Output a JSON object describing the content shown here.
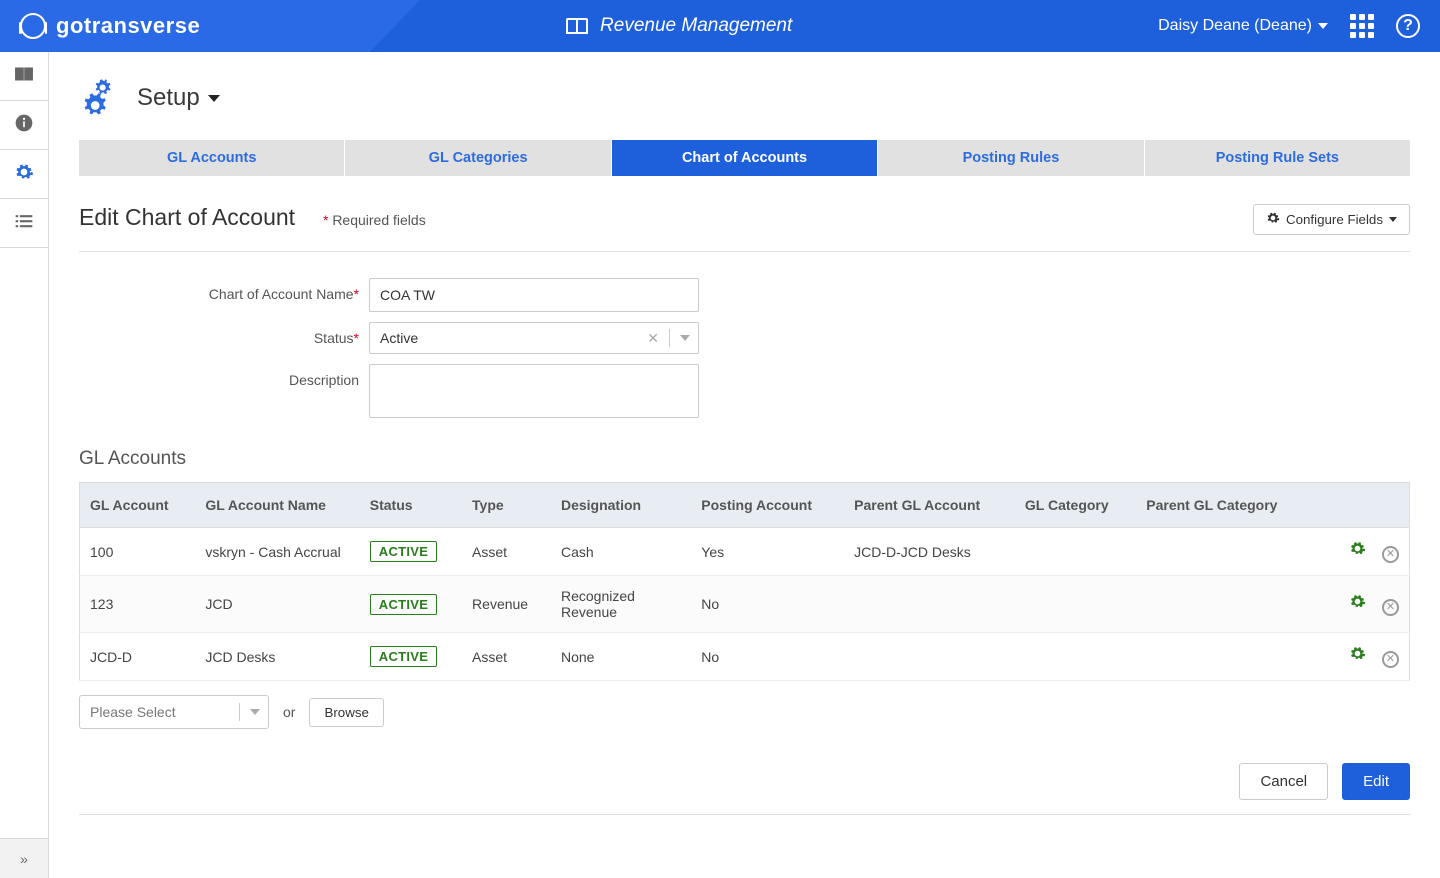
{
  "header": {
    "brand": "gotransverse",
    "module": "Revenue Management",
    "user_display": "Daisy Deane (Deane)"
  },
  "sidebar": {
    "items": [
      {
        "name": "nav-book",
        "icon": "book",
        "active": false
      },
      {
        "name": "nav-info",
        "icon": "info",
        "active": false
      },
      {
        "name": "nav-setup",
        "icon": "gears",
        "active": true
      },
      {
        "name": "nav-list",
        "icon": "list",
        "active": false
      }
    ]
  },
  "page": {
    "title": "Setup"
  },
  "tabs": [
    {
      "label": "GL Accounts",
      "active": false
    },
    {
      "label": "GL Categories",
      "active": false
    },
    {
      "label": "Chart of Accounts",
      "active": true
    },
    {
      "label": "Posting Rules",
      "active": false
    },
    {
      "label": "Posting Rule Sets",
      "active": false
    }
  ],
  "section": {
    "title": "Edit Chart of Account",
    "required_note_prefix": "*",
    "required_note": "Required fields",
    "configure_fields_label": "Configure Fields"
  },
  "form": {
    "fields": {
      "name": {
        "label": "Chart of Account Name",
        "required": true,
        "value": "COA TW"
      },
      "status": {
        "label": "Status",
        "required": true,
        "value": "Active"
      },
      "desc": {
        "label": "Description",
        "required": false,
        "value": ""
      }
    }
  },
  "subsection": {
    "title": "GL Accounts"
  },
  "table": {
    "columns": [
      "GL Account",
      "GL Account Name",
      "Status",
      "Type",
      "Designation",
      "Posting Account",
      "Parent GL Account",
      "GL Category",
      "Parent GL Category"
    ],
    "rows": [
      {
        "gl_account": "100",
        "name": "vskryn - Cash Accrual",
        "status": "ACTIVE",
        "type": "Asset",
        "designation": "Cash",
        "posting": "Yes",
        "parent_gl": "JCD-D-JCD Desks",
        "gl_category": "",
        "parent_gl_category": ""
      },
      {
        "gl_account": "123",
        "name": "JCD",
        "status": "ACTIVE",
        "type": "Revenue",
        "designation": "Recognized Revenue",
        "posting": "No",
        "parent_gl": "",
        "gl_category": "",
        "parent_gl_category": ""
      },
      {
        "gl_account": "JCD-D",
        "name": "JCD Desks",
        "status": "ACTIVE",
        "type": "Asset",
        "designation": "None",
        "posting": "No",
        "parent_gl": "",
        "gl_category": "",
        "parent_gl_category": ""
      }
    ]
  },
  "below_table": {
    "select_placeholder": "Please Select",
    "or_label": "or",
    "browse_label": "Browse"
  },
  "footer": {
    "cancel": "Cancel",
    "submit": "Edit"
  }
}
